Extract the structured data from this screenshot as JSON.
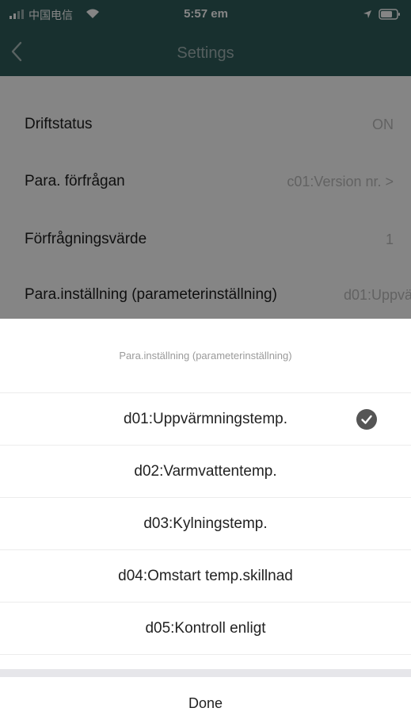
{
  "status_bar": {
    "carrier": "中国电信",
    "time": "5:57 em"
  },
  "nav": {
    "title": "Settings",
    "back_icon": "chevron-left-icon"
  },
  "settings": [
    {
      "label": "Driftstatus",
      "value": "ON"
    },
    {
      "label": "Para. förfrågan",
      "value": "c01:Version nr. >"
    },
    {
      "label": "Förfrågningsvärde",
      "value": "1"
    },
    {
      "label": "Para.inställning (parameterinställning)",
      "value": "d01:Uppvär"
    }
  ],
  "picker": {
    "title": "Para.inställning (parameterinställning)",
    "options": [
      {
        "label": "d01:Uppvärmningstemp.",
        "selected": true
      },
      {
        "label": "d02:Varmvattentemp.",
        "selected": false
      },
      {
        "label": "d03:Kylningstemp.",
        "selected": false
      },
      {
        "label": "d04:Omstart temp.skillnad",
        "selected": false
      },
      {
        "label": "d05:Kontroll enligt",
        "selected": false
      }
    ],
    "done_label": "Done",
    "check_icon": "checkmark-circle-icon"
  },
  "colors": {
    "header": "#2f5c5b",
    "selected_check": "#555555",
    "value_text": "#bdbdbd"
  }
}
